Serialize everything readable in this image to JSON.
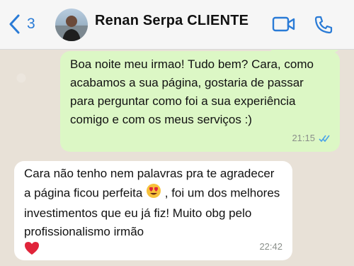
{
  "header": {
    "back_count": "3",
    "contact_name": "Renan Serpa CLIENTE",
    "icons": {
      "back": "chevron-left-icon",
      "video": "video-call-icon",
      "phone": "phone-icon"
    },
    "accent_color": "#2a7bd6"
  },
  "messages": [
    {
      "direction": "outgoing",
      "text": "Boa noite meu irmao! Tudo bem? Cara, como acabamos a sua página, gostaria de passar para perguntar como foi a sua experiência comigo e com os meus serviços :)",
      "time": "21:15",
      "status": "read"
    },
    {
      "direction": "incoming",
      "text_part1": "Cara não tenho nem palavras pra te agradecer a página ficou perfeita",
      "emoji1": "heart-eyes-emoji",
      "text_part2": " , foi um dos melhores investimentos que eu já fiz! Muito obg pelo profissionalismo irmão",
      "emoji2": "red-heart-emoji",
      "time": "22:42"
    }
  ],
  "colors": {
    "outgoing_bubble": "#dcf7c5",
    "incoming_bubble": "#ffffff",
    "read_ticks": "#4aa3e8"
  }
}
